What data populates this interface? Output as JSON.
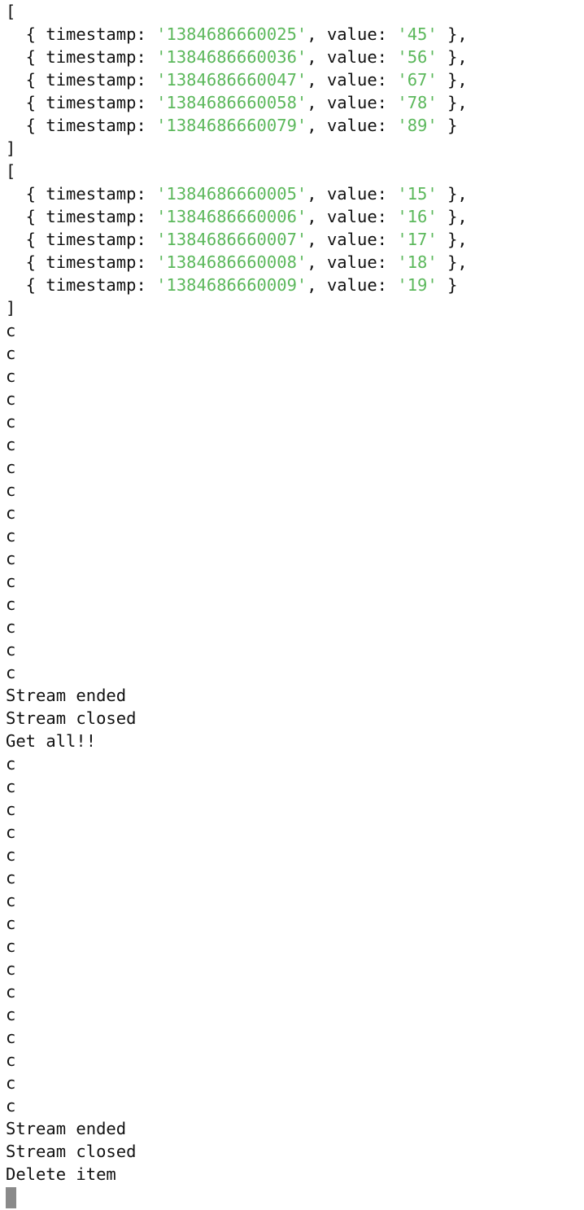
{
  "colors": {
    "background": "#ffffff",
    "text": "#111111",
    "string": "#5cb85c",
    "cursor": "#8a8a8a"
  },
  "terminal": {
    "lines": [
      {
        "segments": [
          {
            "t": "["
          }
        ]
      },
      {
        "segments": [
          {
            "t": "  { timestamp: "
          },
          {
            "t": "'1384686660025'",
            "c": "string"
          },
          {
            "t": ", value: "
          },
          {
            "t": "'45'",
            "c": "string"
          },
          {
            "t": " },"
          }
        ]
      },
      {
        "segments": [
          {
            "t": "  { timestamp: "
          },
          {
            "t": "'1384686660036'",
            "c": "string"
          },
          {
            "t": ", value: "
          },
          {
            "t": "'56'",
            "c": "string"
          },
          {
            "t": " },"
          }
        ]
      },
      {
        "segments": [
          {
            "t": "  { timestamp: "
          },
          {
            "t": "'1384686660047'",
            "c": "string"
          },
          {
            "t": ", value: "
          },
          {
            "t": "'67'",
            "c": "string"
          },
          {
            "t": " },"
          }
        ]
      },
      {
        "segments": [
          {
            "t": "  { timestamp: "
          },
          {
            "t": "'1384686660058'",
            "c": "string"
          },
          {
            "t": ", value: "
          },
          {
            "t": "'78'",
            "c": "string"
          },
          {
            "t": " },"
          }
        ]
      },
      {
        "segments": [
          {
            "t": "  { timestamp: "
          },
          {
            "t": "'1384686660079'",
            "c": "string"
          },
          {
            "t": ", value: "
          },
          {
            "t": "'89'",
            "c": "string"
          },
          {
            "t": " }"
          }
        ]
      },
      {
        "segments": [
          {
            "t": "]"
          }
        ]
      },
      {
        "segments": [
          {
            "t": "["
          }
        ]
      },
      {
        "segments": [
          {
            "t": "  { timestamp: "
          },
          {
            "t": "'1384686660005'",
            "c": "string"
          },
          {
            "t": ", value: "
          },
          {
            "t": "'15'",
            "c": "string"
          },
          {
            "t": " },"
          }
        ]
      },
      {
        "segments": [
          {
            "t": "  { timestamp: "
          },
          {
            "t": "'1384686660006'",
            "c": "string"
          },
          {
            "t": ", value: "
          },
          {
            "t": "'16'",
            "c": "string"
          },
          {
            "t": " },"
          }
        ]
      },
      {
        "segments": [
          {
            "t": "  { timestamp: "
          },
          {
            "t": "'1384686660007'",
            "c": "string"
          },
          {
            "t": ", value: "
          },
          {
            "t": "'17'",
            "c": "string"
          },
          {
            "t": " },"
          }
        ]
      },
      {
        "segments": [
          {
            "t": "  { timestamp: "
          },
          {
            "t": "'1384686660008'",
            "c": "string"
          },
          {
            "t": ", value: "
          },
          {
            "t": "'18'",
            "c": "string"
          },
          {
            "t": " },"
          }
        ]
      },
      {
        "segments": [
          {
            "t": "  { timestamp: "
          },
          {
            "t": "'1384686660009'",
            "c": "string"
          },
          {
            "t": ", value: "
          },
          {
            "t": "'19'",
            "c": "string"
          },
          {
            "t": " }"
          }
        ]
      },
      {
        "segments": [
          {
            "t": "]"
          }
        ]
      },
      {
        "segments": [
          {
            "t": "c"
          }
        ]
      },
      {
        "segments": [
          {
            "t": "c"
          }
        ]
      },
      {
        "segments": [
          {
            "t": "c"
          }
        ]
      },
      {
        "segments": [
          {
            "t": "c"
          }
        ]
      },
      {
        "segments": [
          {
            "t": "c"
          }
        ]
      },
      {
        "segments": [
          {
            "t": "c"
          }
        ]
      },
      {
        "segments": [
          {
            "t": "c"
          }
        ]
      },
      {
        "segments": [
          {
            "t": "c"
          }
        ]
      },
      {
        "segments": [
          {
            "t": "c"
          }
        ]
      },
      {
        "segments": [
          {
            "t": "c"
          }
        ]
      },
      {
        "segments": [
          {
            "t": "c"
          }
        ]
      },
      {
        "segments": [
          {
            "t": "c"
          }
        ]
      },
      {
        "segments": [
          {
            "t": "c"
          }
        ]
      },
      {
        "segments": [
          {
            "t": "c"
          }
        ]
      },
      {
        "segments": [
          {
            "t": "c"
          }
        ]
      },
      {
        "segments": [
          {
            "t": "c"
          }
        ]
      },
      {
        "segments": [
          {
            "t": "Stream ended"
          }
        ]
      },
      {
        "segments": [
          {
            "t": "Stream closed"
          }
        ]
      },
      {
        "segments": [
          {
            "t": "Get all!!"
          }
        ]
      },
      {
        "segments": [
          {
            "t": "c"
          }
        ]
      },
      {
        "segments": [
          {
            "t": "c"
          }
        ]
      },
      {
        "segments": [
          {
            "t": "c"
          }
        ]
      },
      {
        "segments": [
          {
            "t": "c"
          }
        ]
      },
      {
        "segments": [
          {
            "t": "c"
          }
        ]
      },
      {
        "segments": [
          {
            "t": "c"
          }
        ]
      },
      {
        "segments": [
          {
            "t": "c"
          }
        ]
      },
      {
        "segments": [
          {
            "t": "c"
          }
        ]
      },
      {
        "segments": [
          {
            "t": "c"
          }
        ]
      },
      {
        "segments": [
          {
            "t": "c"
          }
        ]
      },
      {
        "segments": [
          {
            "t": "c"
          }
        ]
      },
      {
        "segments": [
          {
            "t": "c"
          }
        ]
      },
      {
        "segments": [
          {
            "t": "c"
          }
        ]
      },
      {
        "segments": [
          {
            "t": "c"
          }
        ]
      },
      {
        "segments": [
          {
            "t": "c"
          }
        ]
      },
      {
        "segments": [
          {
            "t": "c"
          }
        ]
      },
      {
        "segments": [
          {
            "t": "Stream ended"
          }
        ]
      },
      {
        "segments": [
          {
            "t": "Stream closed"
          }
        ]
      },
      {
        "segments": [
          {
            "t": "Delete item"
          }
        ]
      }
    ]
  }
}
